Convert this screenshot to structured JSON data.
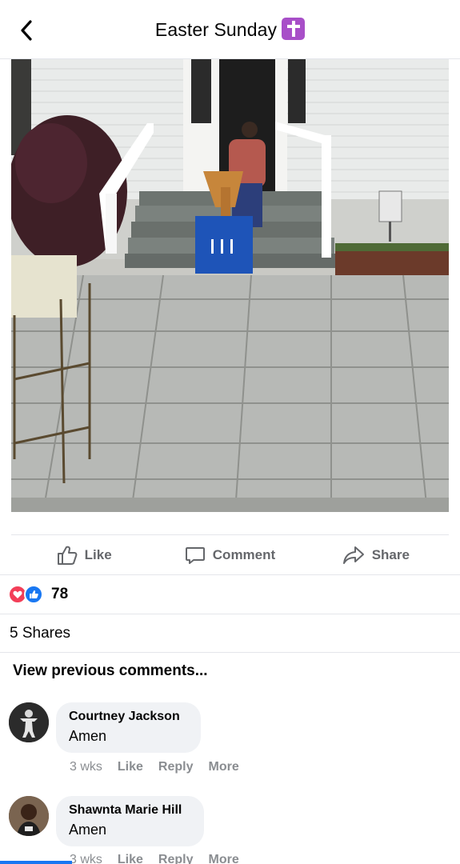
{
  "header": {
    "title": "Easter Sunday",
    "icons": {
      "back": "chevron-left-icon",
      "emoji": "latin-cross-emoji"
    }
  },
  "video": {
    "description_icons": [
      "church-steps",
      "podium",
      "sign"
    ]
  },
  "actions": {
    "like_label": "Like",
    "comment_label": "Comment",
    "share_label": "Share"
  },
  "reactions": {
    "count": "78",
    "types": [
      "love",
      "like"
    ]
  },
  "shares": {
    "label": "5 Shares"
  },
  "comments_section": {
    "view_previous": "View previous comments...",
    "comments": [
      {
        "name": "Courtney Jackson",
        "text": "Amen",
        "time": "3 wks",
        "like": "Like",
        "reply": "Reply",
        "more": "More"
      },
      {
        "name": "Shawnta Marie Hill",
        "text": "Amen",
        "time": "3 wks",
        "like": "Like",
        "reply": "Reply",
        "more": "More"
      }
    ]
  },
  "colors": {
    "accent": "#1877f2",
    "love": "#f33e58",
    "muted_text": "#65676b",
    "bubble_bg": "#f0f2f5",
    "cross_emoji_bg": "#a84fc8"
  }
}
